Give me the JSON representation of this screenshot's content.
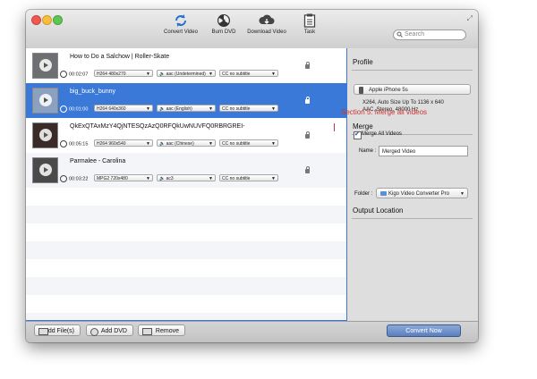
{
  "toolbar": {
    "buttons": [
      {
        "label": "Convert Video",
        "icon": "convert-icon"
      },
      {
        "label": "Burn DVD",
        "icon": "burn-icon"
      },
      {
        "label": "Download Video",
        "icon": "download-icon"
      },
      {
        "label": "Task",
        "icon": "task-icon"
      }
    ],
    "search_placeholder": "Search"
  },
  "files": [
    {
      "title": "How to Do a Salchow | Roller-Skate",
      "duration": "00:02:07",
      "video": "H264 480x270",
      "audio": "aac (Undetermined)",
      "subtitle": "no subtitle",
      "selected": false
    },
    {
      "title": "big_buck_bunny",
      "duration": "00:01:00",
      "video": "H264 640x360",
      "audio": "aac (English)",
      "subtitle": "no subtitle",
      "selected": true
    },
    {
      "title": "QkExQTAxMzY4QjNTESQzAzQ0RFQkUwNUVFQ0RBRGREI-",
      "duration": "00:05:15",
      "video": "H264 960x540",
      "audio": "aac (Chinese)",
      "subtitle": "no subtitle",
      "selected": false
    },
    {
      "title": "Parmalee - Carolina",
      "duration": "00:03:22",
      "video": "MPG2 720x480",
      "audio": "ac3",
      "subtitle": "no subtitle",
      "selected": false
    }
  ],
  "cc_label": "CC",
  "profile": {
    "heading": "Profile",
    "device": "Apple iPhone 5s",
    "info_line1": "X264, Auto Size Up To 1136 x 640",
    "info_line2": "AAC, Stereo, 48000 Hz"
  },
  "merge": {
    "heading": "Merge",
    "checkbox_label": "Merge All Videos",
    "checked": true,
    "name_label": "Name :",
    "name_value": "Merged Video"
  },
  "annotation": "Section 5: Merge all videos",
  "output": {
    "heading": "Output Location",
    "folder_label": "Folder :",
    "folder_value": "Kigo Video Converter Pro"
  },
  "bottom": {
    "add_files": "Add File(s)",
    "add_dvd": "Add DVD",
    "remove": "Remove",
    "convert_now": "Convert Now"
  },
  "colors": {
    "selection": "#3b79d8",
    "annotation": "#cc3333"
  }
}
